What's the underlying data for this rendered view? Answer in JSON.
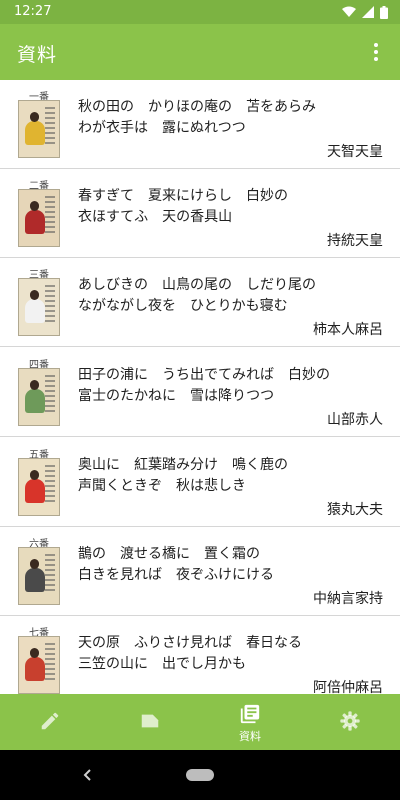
{
  "status_bar": {
    "time": "12:27"
  },
  "app_bar": {
    "title": "資料"
  },
  "poems": [
    {
      "number": "一番",
      "line1": "秋の田の　かりほの庵の　苫をあらみ",
      "line2": "わが衣手は　露にぬれつつ",
      "author": "天智天皇"
    },
    {
      "number": "二番",
      "line1": "春すぎて　夏来にけらし　白妙の",
      "line2": "衣ほすてふ　天の香具山",
      "author": "持統天皇"
    },
    {
      "number": "三番",
      "line1": "あしびきの　山鳥の尾の　しだり尾の",
      "line2": "ながながし夜を　ひとりかも寝む",
      "author": "柿本人麻呂"
    },
    {
      "number": "四番",
      "line1": "田子の浦に　うち出でてみれば　白妙の",
      "line2": "富士のたかねに　雪は降りつつ",
      "author": "山部赤人"
    },
    {
      "number": "五番",
      "line1": "奥山に　紅葉踏み分け　鳴く鹿の",
      "line2": "声聞くときぞ　秋は悲しき",
      "author": "猿丸大夫"
    },
    {
      "number": "六番",
      "line1": "鵲の　渡せる橋に　置く霜の",
      "line2": "白きを見れば　夜ぞふけにける",
      "author": "中納言家持"
    },
    {
      "number": "七番",
      "line1": "天の原　ふりさけ見れば　春日なる",
      "line2": "三笠の山に　出でし月かも",
      "author": "阿倍仲麻呂"
    }
  ],
  "bottom_nav": {
    "items": [
      {
        "icon": "pencil-icon",
        "label": ""
      },
      {
        "icon": "label-icon",
        "label": ""
      },
      {
        "icon": "library-books-icon",
        "label": "資料"
      },
      {
        "icon": "gear-icon",
        "label": ""
      }
    ],
    "active_index": 2
  },
  "colors": {
    "accent": "#8bc34a",
    "status_bar": "#7cb342",
    "card_palettes": [
      [
        "#e9dcc0",
        "#e0b430"
      ],
      [
        "#e6d6b8",
        "#b02a2a"
      ],
      [
        "#ece3cc",
        "#f2f2f2"
      ],
      [
        "#e8dcc0",
        "#6e9a5a"
      ],
      [
        "#ece0c4",
        "#d8342a"
      ],
      [
        "#e7dbbd",
        "#4a4a4a"
      ],
      [
        "#ebdcc0",
        "#c8402e"
      ]
    ]
  }
}
